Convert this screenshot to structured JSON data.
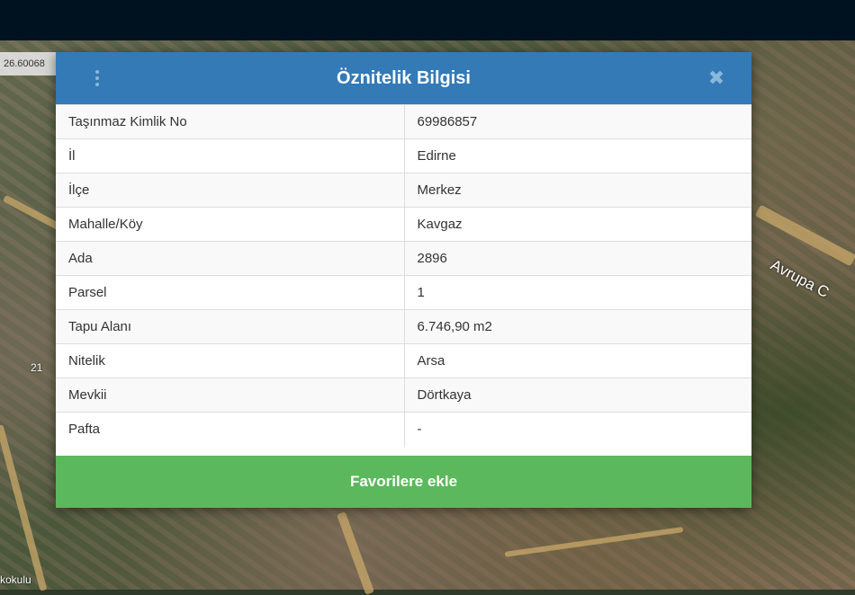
{
  "map": {
    "coordinate_readout": "26.60068",
    "street_label": "Avrupa C",
    "building_label_1": "21",
    "bottom_label": "kokulu"
  },
  "modal": {
    "title": "Öznitelik Bilgisi",
    "menu_icon": "vertical-dots-icon",
    "close_icon": "close-icon",
    "rows": [
      {
        "key": "Taşınmaz Kimlik No",
        "value": "69986857"
      },
      {
        "key": "İl",
        "value": "Edirne"
      },
      {
        "key": "İlçe",
        "value": "Merkez"
      },
      {
        "key": "Mahalle/Köy",
        "value": "Kavgaz"
      },
      {
        "key": "Ada",
        "value": "2896"
      },
      {
        "key": "Parsel",
        "value": "1"
      },
      {
        "key": "Tapu Alanı",
        "value": "6.746,90 m2"
      },
      {
        "key": "Nitelik",
        "value": "Arsa"
      },
      {
        "key": "Mevkii",
        "value": "Dörtkaya"
      },
      {
        "key": "Pafta",
        "value": "-"
      }
    ],
    "favorite_button_label": "Favorilere ekle"
  },
  "colors": {
    "header": "#337ab7",
    "button": "#5cb85c",
    "topbar": "#001220"
  }
}
